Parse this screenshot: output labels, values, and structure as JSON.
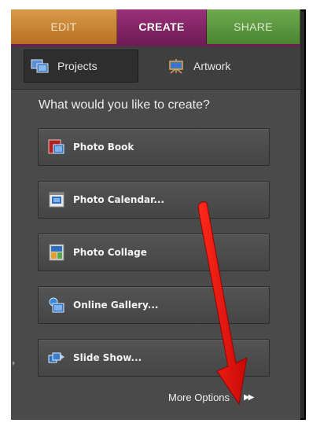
{
  "tabs": {
    "edit": "EDIT",
    "create": "CREATE",
    "share": "SHARE"
  },
  "subtabs": {
    "projects": "Projects",
    "artwork": "Artwork"
  },
  "heading": "What would you like to create?",
  "buttons": [
    {
      "label": "Photo Book",
      "icon": "photo-book-icon"
    },
    {
      "label": "Photo Calendar...",
      "icon": "photo-calendar-icon"
    },
    {
      "label": "Photo Collage",
      "icon": "photo-collage-icon"
    },
    {
      "label": "Online Gallery...",
      "icon": "online-gallery-icon"
    },
    {
      "label": "Slide Show...",
      "icon": "slide-show-icon"
    }
  ],
  "more_options": "More Options",
  "colors": {
    "edit_tab": "#c8843a",
    "create_tab": "#8a2868",
    "share_tab": "#5e973f",
    "annotation_arrow": "#e01010"
  }
}
